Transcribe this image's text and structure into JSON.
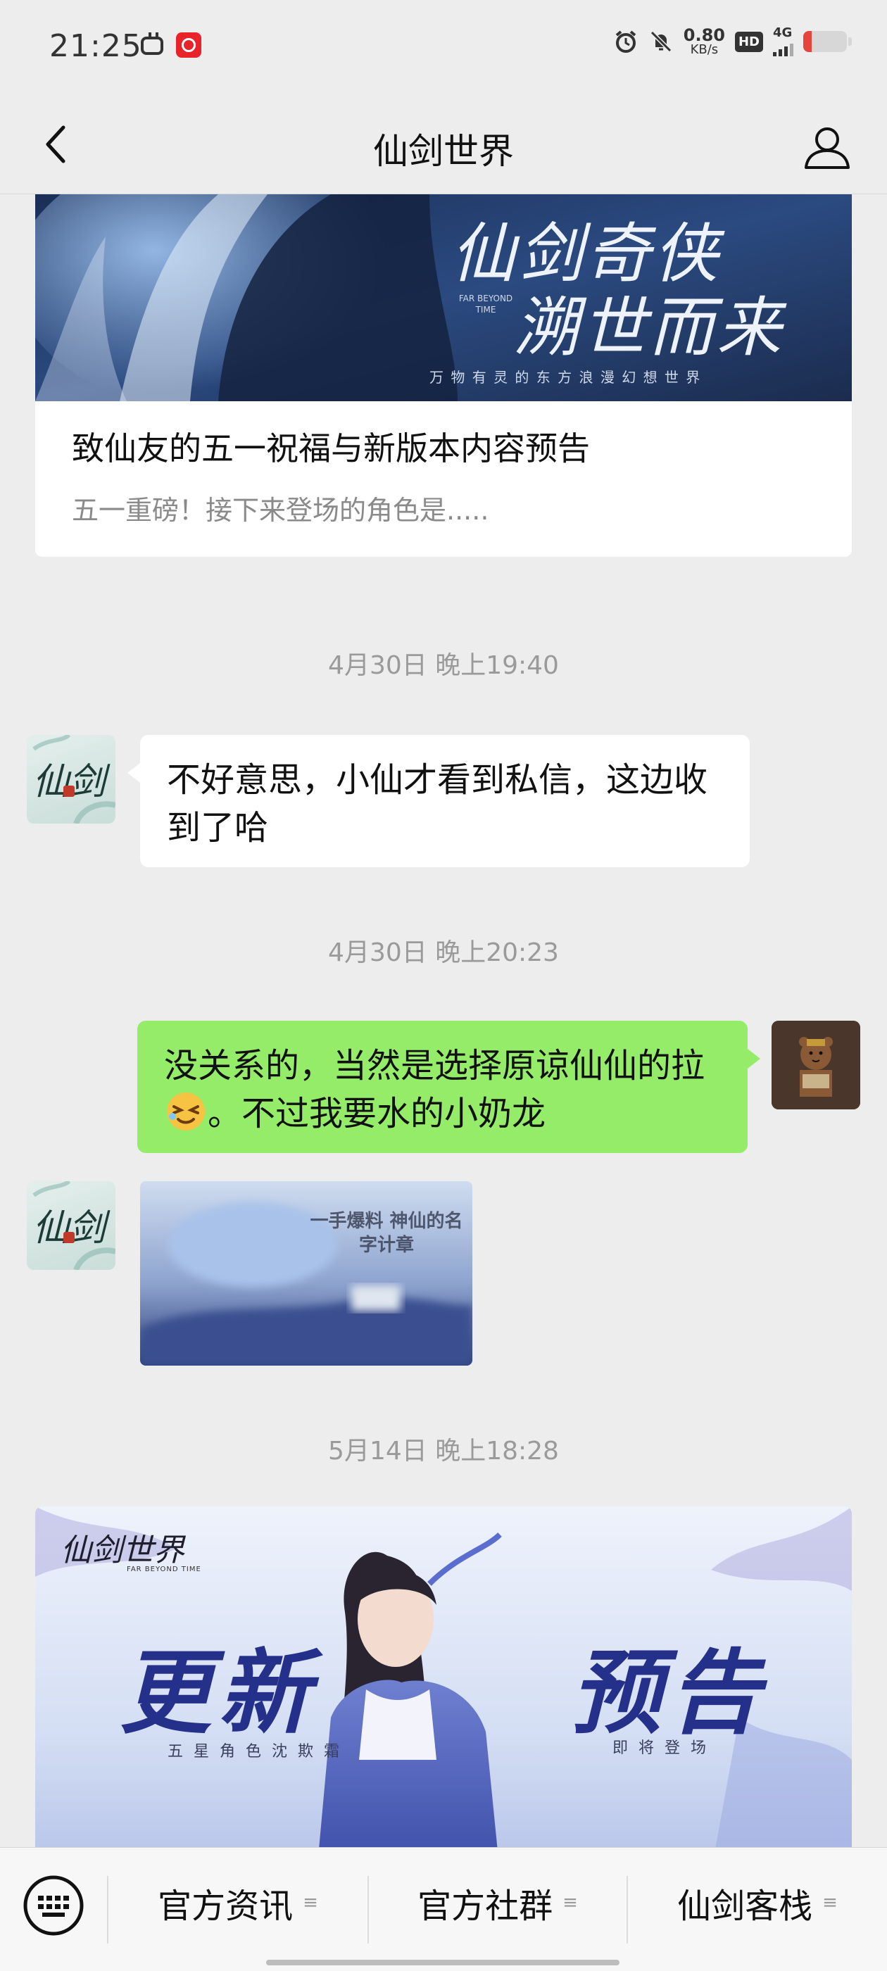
{
  "status_bar": {
    "time": "21:25",
    "net_speed_value": "0.80",
    "net_speed_unit": "KB/s",
    "hd": "HD",
    "network": "4G",
    "battery_percent": 20
  },
  "header": {
    "title": "仙剑世界",
    "back_icon": "chevron-left-icon",
    "profile_icon": "person-icon"
  },
  "messages": {
    "article": {
      "title": "致仙友的五一祝福与新版本内容预告",
      "subtitle": "五一重磅！接下来登场的角色是.....",
      "banner_big": "仙剑奇侠",
      "banner_big2": "溯世而来",
      "banner_small": "万 物 有 灵 的 东 方 浪 漫 幻 想 世 界",
      "banner_en": "FAR BEYOND TIME"
    },
    "ts1": "4月30日 晚上19:40",
    "msg1": "不好意思，小仙才看到私信，这边收到了哈",
    "ts2": "4月30日 晚上20:23",
    "msg2_a": "没关系的，当然是选择原谅仙仙的拉",
    "msg2_b": "。不过我要水的小奶龙",
    "image_caption": "一手爆料 神仙的名字计章",
    "ts3": "5月14日 晚上18:28",
    "banner2": {
      "logo": "仙剑世界",
      "logo_en": "FAR BEYOND TIME",
      "big_left": "更新",
      "big_right": "预告",
      "sub_left": "五 星 角 色 沈 欺 霜",
      "sub_right": "即 将 登 场"
    }
  },
  "avatar_text": "仙剑",
  "bottom_menu": {
    "items": [
      "官方资讯",
      "官方社群",
      "仙剑客栈"
    ],
    "menu_marker": "≡"
  },
  "colors": {
    "background": "#ededed",
    "bubble_out": "#95ec69",
    "bubble_in": "#ffffff"
  }
}
